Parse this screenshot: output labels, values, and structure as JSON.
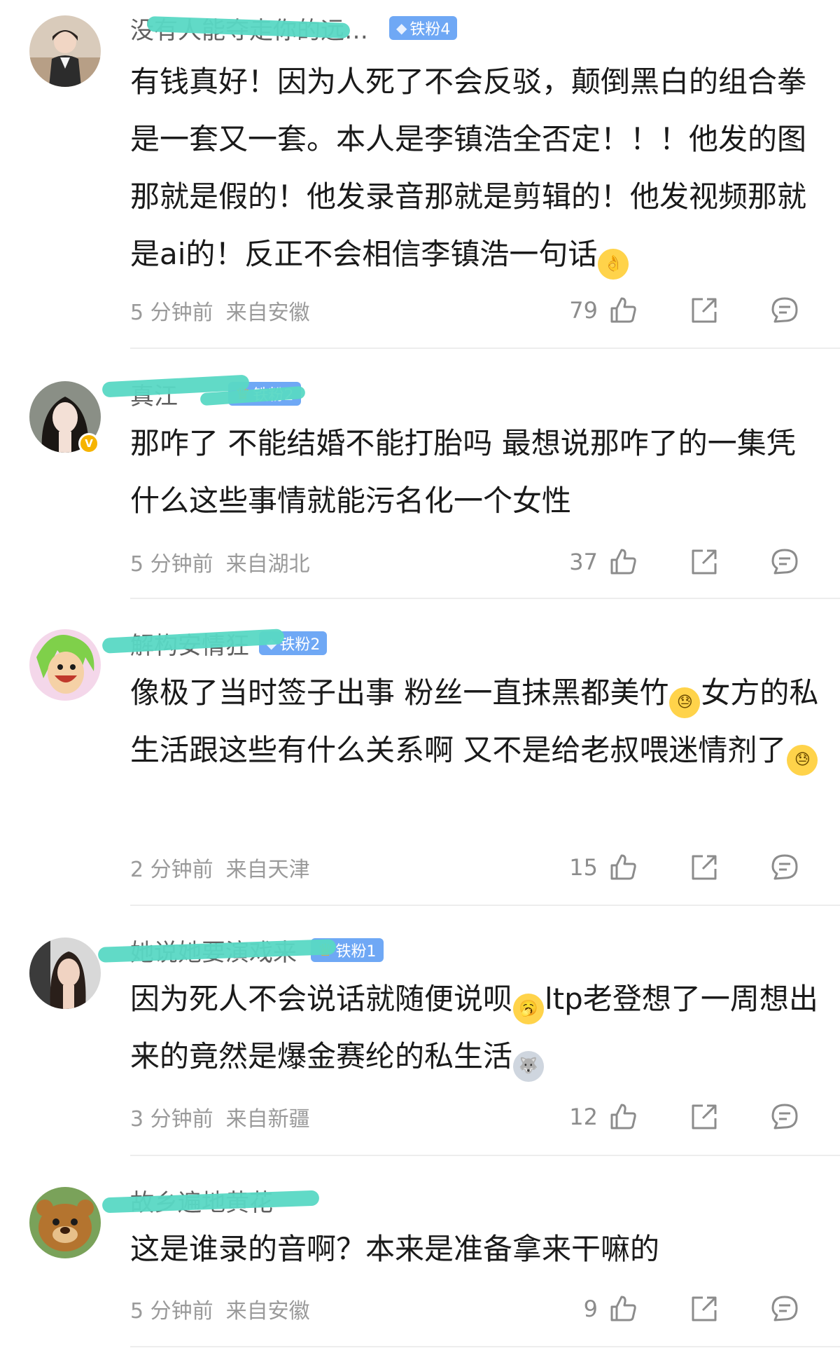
{
  "comments": [
    {
      "username": "没有人能夺走你的远…",
      "fan_badge": "铁粉4",
      "badge_icon": "diamond-icon",
      "text": "有钱真好！因为人死了不会反驳，颠倒黑白的组合拳是一套又一套。本人是李镇浩全否定！！！他发的图那就是假的！他发录音那就是剪辑的！他发视频那就是ai的！反正不会相信李镇浩一句话",
      "emoji": "ok-hand-emoji",
      "time": "5 分钟前",
      "location": "来自安徽",
      "likes": "79"
    },
    {
      "username": "真江",
      "fan_badge": "铁粉2",
      "badge_icon": "crown-icon",
      "verified": true,
      "text": "那咋了 不能结婚不能打胎吗 最想说那咋了的一集凭什么这些事情就能污名化一个女性",
      "time": "5 分钟前",
      "location": "来自湖北",
      "likes": "37"
    },
    {
      "username": "解构安情狂",
      "fan_badge": "铁粉2",
      "badge_icon": "diamond-icon",
      "text_a": "像极了当时签子出事 粉丝一直抹黑都美竹",
      "text_b": "女方的私生活跟这些有什么关系啊 又不是给老叔喂迷情剂了",
      "emoji": "sweat-emoji",
      "time": "2 分钟前",
      "location": "来自天津",
      "likes": "15"
    },
    {
      "username": "她说她要演戏来",
      "fan_badge": "铁粉1",
      "badge_icon": "crown-icon",
      "text_a": "因为死人不会说话就随便说呗",
      "text_b": "ltp老登想了一周想出来的竟然是爆金赛纶的私生活",
      "emoji_a": "yawn-emoji",
      "emoji_b": "husky-emoji",
      "time": "3 分钟前",
      "location": "来自新疆",
      "likes": "12"
    },
    {
      "username": "故乡遍地黄花",
      "text": "这是谁录的音啊？本来是准备拿来干嘛的",
      "time": "5 分钟前",
      "location": "来自安徽",
      "likes": "9"
    }
  ],
  "colors": {
    "fan_badge": "#6fa8f5",
    "mask": "#58d8c4",
    "meta_text": "#9a9a9a",
    "username": "#5f5f5f"
  }
}
